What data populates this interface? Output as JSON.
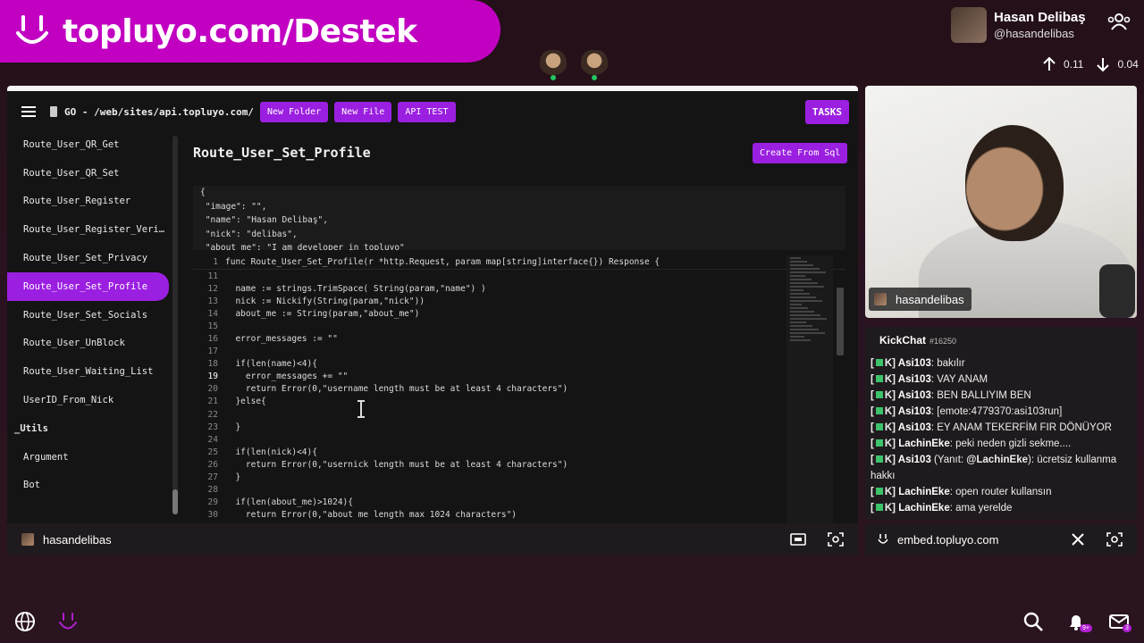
{
  "banner": {
    "text": "topluyo.com/Destek"
  },
  "user": {
    "name": "Hasan Delibaş",
    "handle": "@hasandelibas"
  },
  "network": {
    "up": "0.11",
    "down": "0.04"
  },
  "editor": {
    "language": "GO",
    "path": "/web/sites/api.topluyo.com/",
    "buttons": [
      "New Folder",
      "New File",
      "API TEST"
    ],
    "tasks_label": "TASKS",
    "route_title": "Route_User_Set_Profile",
    "create_label": "Create From Sql",
    "sidebar": [
      {
        "label": "Route_User_QR_Get",
        "active": false,
        "group": false
      },
      {
        "label": "Route_User_QR_Set",
        "active": false,
        "group": false
      },
      {
        "label": "Route_User_Register",
        "active": false,
        "group": false
      },
      {
        "label": "Route_User_Register_Veri…",
        "active": false,
        "group": false
      },
      {
        "label": "Route_User_Set_Privacy",
        "active": false,
        "group": false
      },
      {
        "label": "Route_User_Set_Profile",
        "active": true,
        "group": false
      },
      {
        "label": "Route_User_Set_Socials",
        "active": false,
        "group": false
      },
      {
        "label": "Route_User_UnBlock",
        "active": false,
        "group": false
      },
      {
        "label": "Route_User_Waiting_List",
        "active": false,
        "group": false
      },
      {
        "label": "UserID_From_Nick",
        "active": false,
        "group": false
      },
      {
        "label": "_Utils",
        "active": false,
        "group": true
      },
      {
        "label": "Argument",
        "active": false,
        "group": false
      },
      {
        "label": "Bot",
        "active": false,
        "group": false
      }
    ],
    "json_lines": [
      "{",
      " \"image\": \"\",",
      " \"name\": \"Hasan Delibaş\",",
      " \"nick\": \"delibas\",",
      " \"about me\": \"I am developer in topluyo\""
    ],
    "header_line": {
      "num": "1",
      "text": "func Route_User_Set_Profile(r *http.Request, param map[string]interface{}) Response {"
    },
    "code_lines": [
      {
        "num": "11",
        "text": ""
      },
      {
        "num": "12",
        "text": "  name := strings.TrimSpace( String(param,\"name\") )"
      },
      {
        "num": "13",
        "text": "  nick := Nickify(String(param,\"nick\"))"
      },
      {
        "num": "14",
        "text": "  about_me := String(param,\"about_me\")"
      },
      {
        "num": "15",
        "text": ""
      },
      {
        "num": "16",
        "text": "  error_messages := \"\""
      },
      {
        "num": "17",
        "text": ""
      },
      {
        "num": "18",
        "text": "  if(len(name)<4){"
      },
      {
        "num": "19",
        "text": "    error_messages += \"\""
      },
      {
        "num": "20",
        "text": "    return Error(0,\"username length must be at least 4 characters\")"
      },
      {
        "num": "21",
        "text": "  }else{"
      },
      {
        "num": "22",
        "text": ""
      },
      {
        "num": "23",
        "text": "  }"
      },
      {
        "num": "24",
        "text": ""
      },
      {
        "num": "25",
        "text": "  if(len(nick)<4){"
      },
      {
        "num": "26",
        "text": "    return Error(0,\"usernick length must be at least 4 characters\")"
      },
      {
        "num": "27",
        "text": "  }"
      },
      {
        "num": "28",
        "text": ""
      },
      {
        "num": "29",
        "text": "  if(len(about_me)>1024){"
      },
      {
        "num": "30",
        "text": "    return Error(0,\"about me length max 1024 characters\")"
      }
    ],
    "current_line": "19",
    "footer_name": "hasandelibas"
  },
  "cam": {
    "tag": "hasandelibas"
  },
  "chat": {
    "title": "KickChat",
    "id": "#16250",
    "messages": [
      {
        "badge": "K",
        "user": "Asi103",
        "text": ": bakılır"
      },
      {
        "badge": "K",
        "user": "Asi103",
        "text": ": VAY ANAM"
      },
      {
        "badge": "K",
        "user": "Asi103",
        "text": ": BEN BALLIYIM BEN"
      },
      {
        "badge": "K",
        "user": "Asi103",
        "text": ": [emote:4779370:asi103run]"
      },
      {
        "badge": "K",
        "user": "Asi103",
        "text": ": EY ANAM TEKERFİM FIR DÖNÜYOR"
      },
      {
        "badge": "K",
        "user": "LachinEke",
        "text": ": peki neden gizli sekme...."
      },
      {
        "badge": "K",
        "user": "Asi103",
        "reply_prefix": " (Yanıt: ",
        "reply_to": "@LachinEke",
        "text": "): ücretsiz kullanma hakkı"
      },
      {
        "badge": "K",
        "user": "LachinEke",
        "text": ": open router kullansın"
      },
      {
        "badge": "K",
        "user": "LachinEke",
        "text": ": ama yerelde"
      }
    ],
    "footer_url": "embed.topluyo.com"
  },
  "bottom": {
    "notif_count": "9+",
    "mail_count": "3"
  },
  "colors": {
    "accent": "#9b1fe0",
    "banner": "#c200c2",
    "background": "#241019"
  }
}
